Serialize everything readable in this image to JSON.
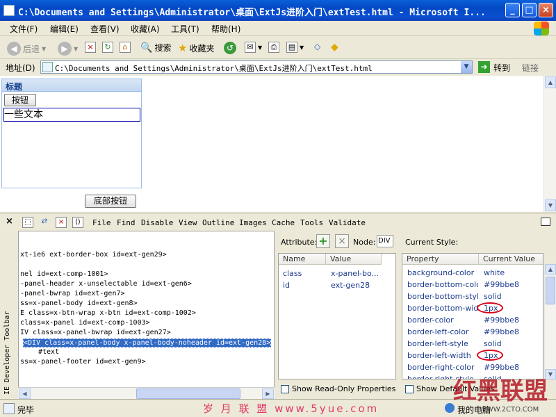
{
  "window": {
    "title": "C:\\Documents and Settings\\Administrator\\桌面\\ExtJs进阶入门\\extTest.html - Microsoft I...",
    "buttons": {
      "minimize": "_",
      "maximize": "□",
      "close": "×"
    }
  },
  "menu": [
    "文件(F)",
    "编辑(E)",
    "查看(V)",
    "收藏(A)",
    "工具(T)",
    "帮助(H)"
  ],
  "toolbar": {
    "back": "后退",
    "search": "搜索",
    "favorites": "收藏夹"
  },
  "address": {
    "label": "地址(D)",
    "value": "C:\\Documents and Settings\\Administrator\\桌面\\ExtJs进阶入门\\extTest.html",
    "go": "转到",
    "links": "链接"
  },
  "page": {
    "panel_title": "标题",
    "button_label": "按钮",
    "text": "一些文本",
    "footer_button": "底部按钮"
  },
  "devtoolbar": {
    "menu": [
      "File",
      "Find",
      "Disable",
      "View",
      "Outline",
      "Images",
      "Cache",
      "Tools",
      "Validate"
    ],
    "side_label": "IE Developer Toolbar"
  },
  "dom_tree": {
    "lines": [
      "xt-ie6 ext-border-box id=ext-gen29>",
      "nel id=ext-comp-1001>",
      "-panel-header x-unselectable id=ext-gen6>",
      "-panel-bwrap id=ext-gen7>",
      "ss=x-panel-body id=ext-gen8>",
      "E class=x-btn-wrap x-btn id=ext-comp-1002>",
      "class=x-panel id=ext-comp-1003>",
      "IV class=x-panel-bwrap id=ext-gen27>",
      "<DIV class=x-panel-body x-panel-body-noheader id=ext-gen28>",
      "#text",
      "ss=x-panel-footer id=ext-gen9>"
    ],
    "selected_index": 8
  },
  "attributes": {
    "label": "Attribute:",
    "node_label": "Node:",
    "node_value": "DIV",
    "col_name": "Name",
    "col_value": "Value",
    "rows": [
      {
        "name": "class",
        "value": "x-panel-bo..."
      },
      {
        "name": "id",
        "value": "ext-gen28"
      }
    ],
    "readonly_label": "Show Read-Only Properties"
  },
  "styles": {
    "label": "Current Style:",
    "col_property": "Property",
    "col_value": "Current Value",
    "rows": [
      {
        "property": "background-color",
        "value": "white",
        "circled": false
      },
      {
        "property": "border-bottom-color",
        "value": "#99bbe8",
        "circled": false
      },
      {
        "property": "border-bottom-style",
        "value": "solid",
        "circled": false
      },
      {
        "property": "border-bottom-width",
        "value": "1px",
        "circled": true
      },
      {
        "property": "border-color",
        "value": "#99bbe8",
        "circled": false
      },
      {
        "property": "border-left-color",
        "value": "#99bbe8",
        "circled": false
      },
      {
        "property": "border-left-style",
        "value": "solid",
        "circled": false
      },
      {
        "property": "border-left-width",
        "value": "1px",
        "circled": true
      },
      {
        "property": "border-right-color",
        "value": "#99bbe8",
        "circled": false
      },
      {
        "property": "border-right-style",
        "value": "solid",
        "circled": false
      }
    ],
    "defaults_label": "Show Default Values"
  },
  "status": {
    "text": "完毕",
    "zone": "我的电脑"
  },
  "watermarks": {
    "bottom": "岁 月 联 盟  www.5yue.com",
    "corner": "红黑联盟",
    "corner_url": "WWW.2CTO.COM"
  }
}
